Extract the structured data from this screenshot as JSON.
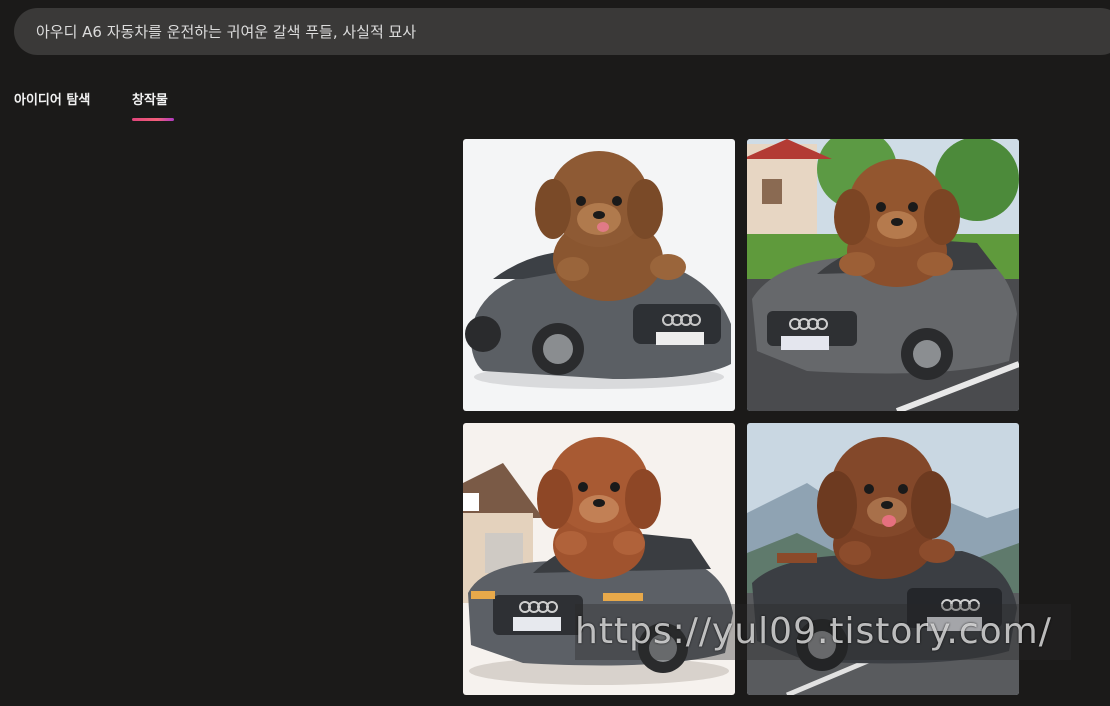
{
  "search": {
    "prompt": "아우디 A6 자동차를 운전하는 귀여운 갈색 푸들, 사실적 묘사"
  },
  "tabs": [
    {
      "label": "아이디어 탐색",
      "active": false
    },
    {
      "label": "창작물",
      "active": true
    }
  ],
  "results": {
    "images": [
      {
        "name": "poodle-audi-image-1",
        "background": "white"
      },
      {
        "name": "poodle-audi-image-2",
        "background": "suburban street"
      },
      {
        "name": "poodle-audi-image-3",
        "background": "house"
      },
      {
        "name": "poodle-audi-image-4",
        "background": "mountains"
      }
    ]
  },
  "watermark": {
    "text": "https://yul09.tistory.com/"
  },
  "colors": {
    "background": "#1b1a19",
    "search_bg": "#3a3938",
    "accent": "#e0457b"
  }
}
